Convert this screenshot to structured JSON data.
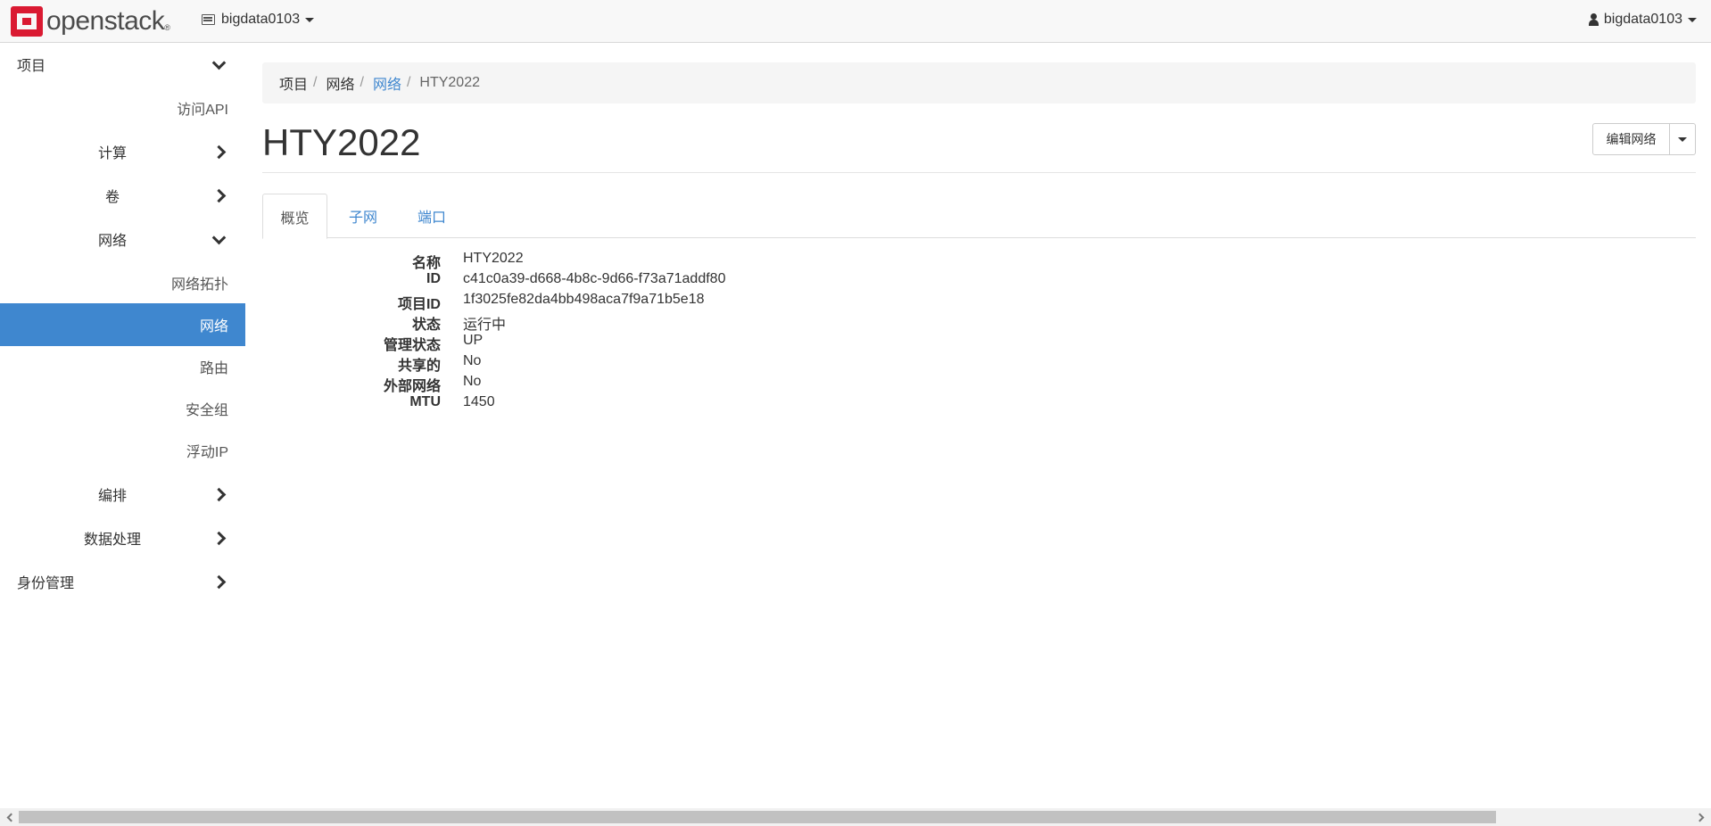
{
  "navbar": {
    "brand": "openstack",
    "brand_mark": "®",
    "project_switcher": "bigdata0103",
    "user_menu": "bigdata0103"
  },
  "sidebar": {
    "items": [
      {
        "label": "项目",
        "icon": "chevron-down-icon"
      },
      {
        "label": "访问API"
      },
      {
        "label": "计算",
        "icon": "chevron-right-icon"
      },
      {
        "label": "卷",
        "icon": "chevron-right-icon"
      },
      {
        "label": "网络",
        "icon": "chevron-down-icon"
      },
      {
        "label": "网络拓扑"
      },
      {
        "label": "网络",
        "active": true
      },
      {
        "label": "路由"
      },
      {
        "label": "安全组"
      },
      {
        "label": "浮动IP"
      },
      {
        "label": "编排",
        "icon": "chevron-right-icon"
      },
      {
        "label": "数据处理",
        "icon": "chevron-right-icon"
      },
      {
        "label": "身份管理",
        "icon": "chevron-right-icon"
      }
    ],
    "active_color": "#3f87cf"
  },
  "breadcrumb": {
    "items": [
      "项目",
      "网络",
      "网络",
      "HTY2022"
    ],
    "separator": "/"
  },
  "page": {
    "title": "HTY2022",
    "edit_button": "编辑网络"
  },
  "tabs": [
    {
      "label": "概览",
      "active": true
    },
    {
      "label": "子网"
    },
    {
      "label": "端口"
    }
  ],
  "details": [
    {
      "label": "名称",
      "value": "HTY2022"
    },
    {
      "label": "ID",
      "value": "c41c0a39-d668-4b8c-9d66-f73a71addf80"
    },
    {
      "label": "项目ID",
      "value": "1f3025fe82da4bb498aca7f9a71b5e18"
    },
    {
      "label": "状态",
      "value": "运行中"
    },
    {
      "label": "管理状态",
      "value": "UP"
    },
    {
      "label": "共享的",
      "value": "No"
    },
    {
      "label": "外部网络",
      "value": "No"
    },
    {
      "label": "MTU",
      "value": "1450"
    }
  ],
  "colors": {
    "link": "#3f87cf",
    "brand_red": "#da1a32"
  }
}
